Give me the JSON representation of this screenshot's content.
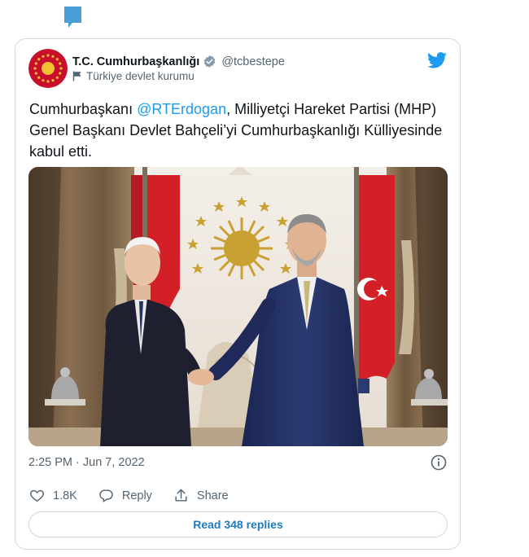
{
  "account": {
    "name": "T.C. Cumhurbaşkanlığı",
    "handle": "@tcbestepe",
    "label": "Türkiye devlet kurumu"
  },
  "tweet": {
    "text_before": "Cumhurbaşkanı ",
    "mention": "@RTErdogan",
    "text_after": ", Milliyetçi Hareket Partisi (MHP) Genel Başkanı Devlet Bahçeli’yi Cumhurbaşkanlığı Külliyesinde kabul etti.",
    "timestamp": "2:25 PM · Jun 7, 2022"
  },
  "actions": {
    "like_count": "1.8K",
    "reply_label": "Reply",
    "share_label": "Share"
  },
  "read_replies_label": "Read 348 replies",
  "colors": {
    "accent": "#1d9bf0",
    "muted": "#536471",
    "border": "#cfd9de",
    "flag_red": "#d32027"
  }
}
